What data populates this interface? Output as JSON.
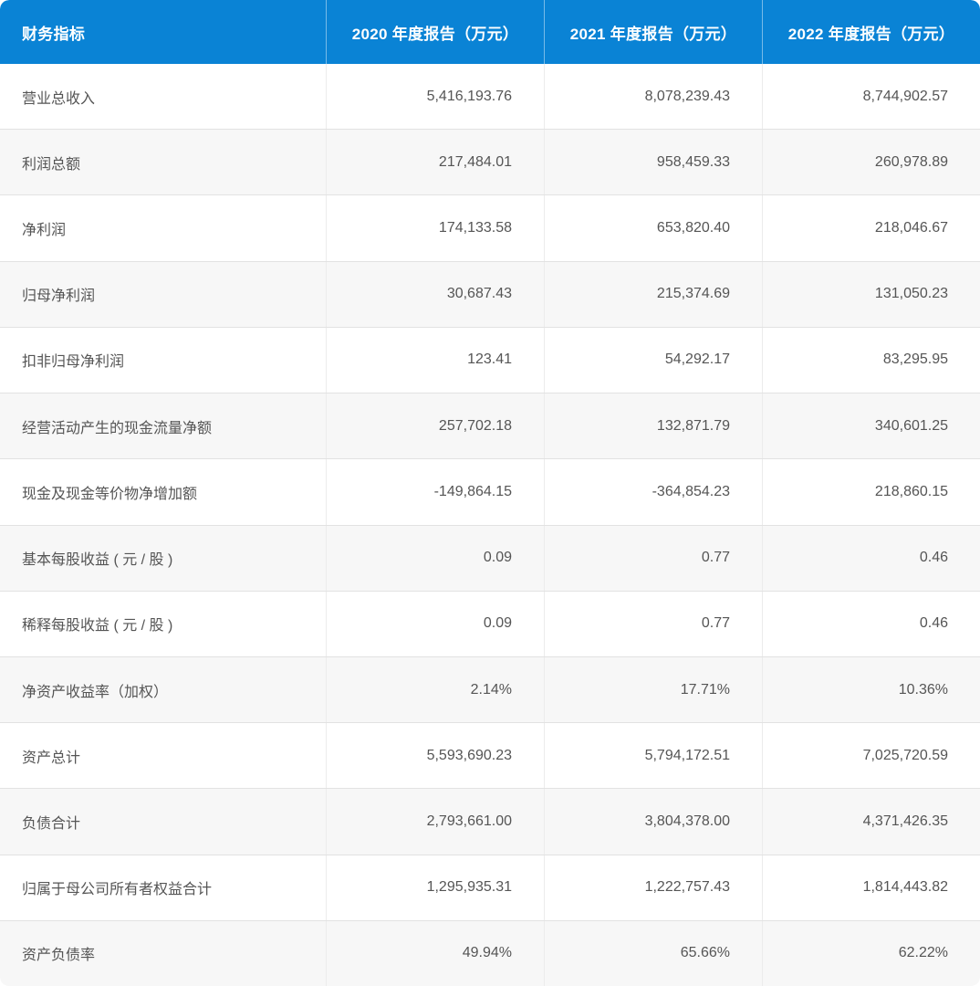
{
  "chart_data": {
    "type": "table",
    "title": "财务指标",
    "columns": [
      "财务指标",
      "2020 年度报告（万元）",
      "2021 年度报告（万元）",
      "2022 年度报告（万元）"
    ],
    "rows": [
      [
        "营业总收入",
        "5,416,193.76",
        "8,078,239.43",
        "8,744,902.57"
      ],
      [
        "利润总额",
        "217,484.01",
        "958,459.33",
        "260,978.89"
      ],
      [
        "净利润",
        "174,133.58",
        "653,820.40",
        "218,046.67"
      ],
      [
        "归母净利润",
        "30,687.43",
        "215,374.69",
        "131,050.23"
      ],
      [
        "扣非归母净利润",
        "123.41",
        "54,292.17",
        "83,295.95"
      ],
      [
        "经营活动产生的现金流量净额",
        "257,702.18",
        "132,871.79",
        "340,601.25"
      ],
      [
        "现金及现金等价物净增加额",
        "-149,864.15",
        "-364,854.23",
        "218,860.15"
      ],
      [
        "基本每股收益 ( 元 / 股 )",
        "0.09",
        "0.77",
        "0.46"
      ],
      [
        "稀释每股收益 ( 元 / 股 )",
        "0.09",
        "0.77",
        "0.46"
      ],
      [
        "净资产收益率（加权）",
        "2.14%",
        "17.71%",
        "10.36%"
      ],
      [
        "资产总计",
        "5,593,690.23",
        "5,794,172.51",
        "7,025,720.59"
      ],
      [
        "负债合计",
        "2,793,661.00",
        "3,804,378.00",
        "4,371,426.35"
      ],
      [
        "归属于母公司所有者权益合计",
        "1,295,935.31",
        "1,222,757.43",
        "1,814,443.82"
      ],
      [
        "资产负债率",
        "49.94%",
        "65.66%",
        "62.22%"
      ]
    ]
  },
  "table": {
    "header": {
      "indicator": "财务指标",
      "years": [
        "2020 年度报告（万元）",
        "2021 年度报告（万元）",
        "2022 年度报告（万元）"
      ]
    },
    "rows": [
      {
        "label": "营业总收入",
        "values": [
          "5,416,193.76",
          "8,078,239.43",
          "8,744,902.57"
        ]
      },
      {
        "label": "利润总额",
        "values": [
          "217,484.01",
          "958,459.33",
          "260,978.89"
        ]
      },
      {
        "label": "净利润",
        "values": [
          "174,133.58",
          "653,820.40",
          "218,046.67"
        ]
      },
      {
        "label": "归母净利润",
        "values": [
          "30,687.43",
          "215,374.69",
          "131,050.23"
        ]
      },
      {
        "label": "扣非归母净利润",
        "values": [
          "123.41",
          "54,292.17",
          "83,295.95"
        ]
      },
      {
        "label": "经营活动产生的现金流量净额",
        "values": [
          "257,702.18",
          "132,871.79",
          "340,601.25"
        ]
      },
      {
        "label": "现金及现金等价物净增加额",
        "values": [
          "-149,864.15",
          "-364,854.23",
          "218,860.15"
        ]
      },
      {
        "label": "基本每股收益 ( 元 / 股 )",
        "values": [
          "0.09",
          "0.77",
          "0.46"
        ]
      },
      {
        "label": "稀释每股收益 ( 元 / 股 )",
        "values": [
          "0.09",
          "0.77",
          "0.46"
        ]
      },
      {
        "label": "净资产收益率（加权）",
        "values": [
          "2.14%",
          "17.71%",
          "10.36%"
        ]
      },
      {
        "label": "资产总计",
        "values": [
          "5,593,690.23",
          "5,794,172.51",
          "7,025,720.59"
        ]
      },
      {
        "label": "负债合计",
        "values": [
          "2,793,661.00",
          "3,804,378.00",
          "4,371,426.35"
        ]
      },
      {
        "label": "归属于母公司所有者权益合计",
        "values": [
          "1,295,935.31",
          "1,222,757.43",
          "1,814,443.82"
        ]
      },
      {
        "label": "资产负债率",
        "values": [
          "49.94%",
          "65.66%",
          "62.22%"
        ]
      }
    ]
  },
  "colors": {
    "header_bg": "#0a83d5",
    "header_text": "#ffffff",
    "header_divider": "rgba(255,255,255,0.45)",
    "row_bg": "#ffffff",
    "row_alt_bg": "#f7f7f7",
    "border_horizontal": "#e2e2e2",
    "border_vertical": "#ececec",
    "text": "#555555"
  }
}
